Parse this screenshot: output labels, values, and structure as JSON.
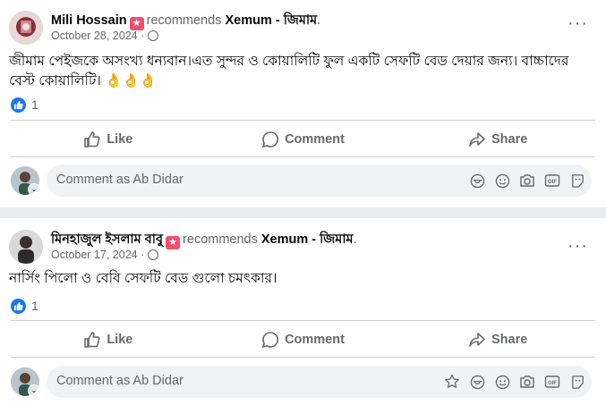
{
  "posts": [
    {
      "author": "Mili Hossain",
      "verb": "recommends",
      "page": "Xemum - জিমাম",
      "date": "October 28, 2024 ·",
      "text": "জীমাম পেইজকে অসংখ্য ধন্যবান।এত সুন্দর ও কোয়ালিটি ফুল একটি সেফটি বেড দেয়ার জন্য। বাচ্চাদের বেস্ট কোয়ালিটি। 👌👌👌",
      "reaction_count": "1",
      "actions": {
        "like": "Like",
        "comment": "Comment",
        "share": "Share"
      },
      "comment_placeholder": "Comment as Ab Didar"
    },
    {
      "author": "মিনহাজুল ইসলাম বাবু",
      "verb": "recommends",
      "page": "Xemum - জিমাম",
      "date": "October 17, 2024 ·",
      "text": "নার্সিং পিলো ও বেবি সেফটি বেড গুলো চমৎকার।",
      "reaction_count": "1",
      "actions": {
        "like": "Like",
        "comment": "Comment",
        "share": "Share"
      },
      "comment_placeholder": "Comment as Ab Didar"
    }
  ],
  "icons": {
    "more": "more-options-icon",
    "privacy": "globe-icon",
    "recommend": "recommend-star-icon",
    "reaction": "like-reaction-icon",
    "comment_tools": [
      "sticker-icon",
      "avatar-sticker-icon",
      "emoji-icon",
      "camera-icon",
      "gif-icon",
      "sticker-face-icon"
    ]
  },
  "colors": {
    "accent": "#1877f2",
    "badge": "#f0506e",
    "muted": "#65676b"
  }
}
